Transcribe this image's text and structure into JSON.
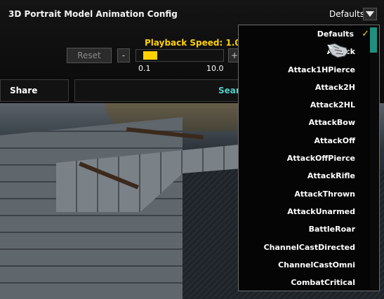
{
  "window": {
    "title": "3D Portrait Model Animation Config"
  },
  "preset": {
    "current": "Defaults"
  },
  "playback": {
    "label": "Playback Speed: 1.0",
    "reset_label": "Reset",
    "minus_label": "-",
    "plus_label": "+",
    "min_label": "0.1",
    "max_label": "10.0",
    "value": 1.0
  },
  "toolbar": {
    "share_label": "Share",
    "search_label": "Searc"
  },
  "dropdown": {
    "items": [
      "Defaults",
      "Attack",
      "Attack1HPierce",
      "Attack2H",
      "Attack2HL",
      "AttackBow",
      "AttackOff",
      "AttackOffPierce",
      "AttackRifle",
      "AttackThrown",
      "AttackUnarmed",
      "BattleRoar",
      "ChannelCastDirected",
      "ChannelCastOmni",
      "CombatCritical"
    ],
    "selected": "Defaults"
  },
  "icons": {
    "dropdown_toggle": "triangle-down-icon",
    "selected_marker": "checkmark-icon",
    "pointer": "gauntlet-cursor-icon"
  },
  "colors": {
    "accent_gold": "#ffd100",
    "search_teal": "#4fd1c5",
    "scrollbar": "#1f8f80"
  }
}
